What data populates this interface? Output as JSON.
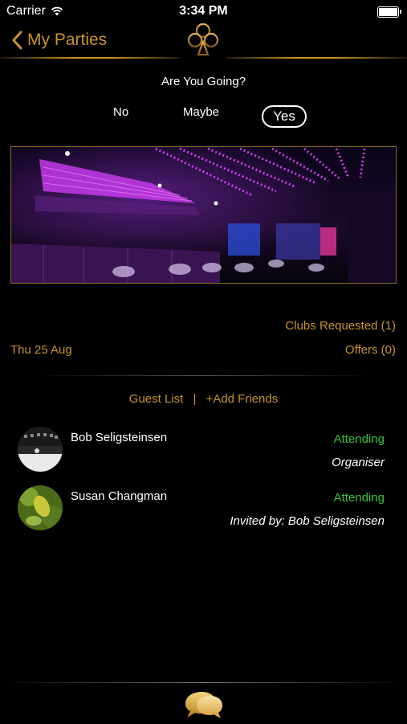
{
  "status_bar": {
    "carrier": "Carrier",
    "time": "3:34 PM"
  },
  "nav": {
    "back_label": "My Parties",
    "logo_icon": "club-suit-icon"
  },
  "rsvp": {
    "question": "Are You Going?",
    "options": [
      "No",
      "Maybe",
      "Yes"
    ],
    "selected": "Yes"
  },
  "party": {
    "date": "Thu 25 Aug",
    "clubs_requested": "Clubs Requested (1)",
    "offers": "Offers (0)"
  },
  "guest_list": {
    "label": "Guest List",
    "separator": "|",
    "add_friends": "+Add Friends",
    "guests": [
      {
        "name": "Bob Seligsteinsen",
        "status": "Attending",
        "role": "Organiser"
      },
      {
        "name": "Susan Changman",
        "status": "Attending",
        "role": "Invited by: Bob Seligsteinsen"
      }
    ]
  },
  "colors": {
    "accent": "#c8922a",
    "attending": "#39c43a",
    "background": "#000000"
  }
}
